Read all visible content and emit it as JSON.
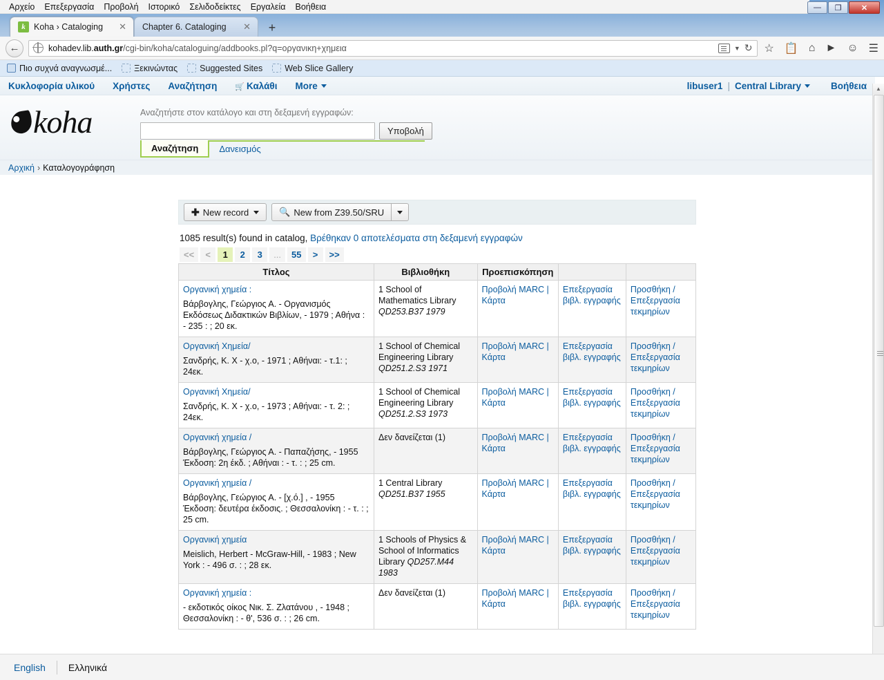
{
  "browser": {
    "menus": [
      "Αρχείο",
      "Επεξεργασία",
      "Προβολή",
      "Ιστορικό",
      "Σελιδοδείκτες",
      "Εργαλεία",
      "Βοήθεια"
    ],
    "window_controls": {
      "minimize": "—",
      "restore": "❐",
      "close": "✕"
    },
    "tabs": [
      {
        "title": "Koha › Cataloging",
        "favicon_letter": "k",
        "active": true,
        "close": "✕"
      },
      {
        "title": "Chapter 6. Cataloging",
        "active": false,
        "close": "✕"
      }
    ],
    "new_tab_label": "+",
    "url": {
      "prefix": "kohadev.lib.",
      "host_bold": "auth.gr",
      "path": "/cgi-bin/koha/cataloguing/addbooks.pl?q=οργανικη+χημεια"
    },
    "bookmarks": [
      {
        "label": "Πιο συχνά αναγνωσμέ...",
        "icon": "feed-icon"
      },
      {
        "label": "Ξεκινώντας",
        "icon": "bookmark-icon"
      },
      {
        "label": "Suggested Sites",
        "icon": "bookmark-icon"
      },
      {
        "label": "Web Slice Gallery",
        "icon": "bookmark-icon"
      }
    ]
  },
  "koha": {
    "nav": [
      {
        "label": "Κυκλοφορία υλικού"
      },
      {
        "label": "Χρήστες"
      },
      {
        "label": "Αναζήτηση"
      },
      {
        "label": "Καλάθι",
        "icon": "cart-icon"
      },
      {
        "label": "More",
        "caret": true
      }
    ],
    "user": "libuser1",
    "library": "Central Library",
    "help": "Βοήθεια",
    "logo_text": "koha",
    "search": {
      "label": "Αναζητήστε στον κατάλογο και στη δεξαμενή εγγραφών:",
      "value": "",
      "placeholder": "",
      "submit": "Υποβολή",
      "tabs": [
        {
          "label": "Αναζήτηση",
          "active": true
        },
        {
          "label": "Δανεισμός",
          "active": false
        }
      ]
    },
    "breadcrumb": {
      "home": "Αρχική",
      "sep": "›",
      "current": "Καταλογογράφηση"
    },
    "toolbar": {
      "new_record": "New record",
      "new_from_z3950": "New from Z39.50/SRU"
    },
    "results_summary_prefix": "1085 result(s) found in catalog,",
    "results_summary_link": "Βρέθηκαν 0 αποτελέσματα στη δεξαμενή εγγραφών",
    "pagination": [
      {
        "label": "<<",
        "state": "disabled"
      },
      {
        "label": "<",
        "state": "disabled"
      },
      {
        "label": "1",
        "state": "current"
      },
      {
        "label": "2",
        "state": "link"
      },
      {
        "label": "3",
        "state": "link"
      },
      {
        "label": "...",
        "state": "dots"
      },
      {
        "label": "55",
        "state": "link"
      },
      {
        "label": ">",
        "state": "link"
      },
      {
        "label": ">>",
        "state": "link"
      }
    ],
    "table": {
      "headers": [
        "Τίτλος",
        "Βιβλιοθήκη",
        "Προεπισκόπηση",
        "",
        ""
      ],
      "rows": [
        {
          "title": "Οργανική χημεία :",
          "details": "Βάρβογλης, Γεώργιος Α. - Οργανισμός Εκδόσεως Διδακτικών Βιβλίων, - 1979 ; Αθήνα : - 235 : ; 20 εκ.",
          "library": "1 School of Mathematics Library",
          "callno": "QD253.B37 1979",
          "preview": "Προβολή MARC | Κάρτα",
          "edit": "Επεξεργασία βιβλ. εγγραφής",
          "items": "Προσθήκη / Επεξεργασία τεκμηρίων"
        },
        {
          "title": "Οργανική Χημεία/",
          "details": "Σανδρής, Κ. Χ - χ.ο, - 1971 ; Αθήναι: - τ.1: ; 24εκ.",
          "library": "1 School of Chemical Engineering Library",
          "callno": "QD251.2.S3 1971",
          "preview": "Προβολή MARC | Κάρτα",
          "edit": "Επεξεργασία βιβλ. εγγραφής",
          "items": "Προσθήκη / Επεξεργασία τεκμηρίων"
        },
        {
          "title": "Οργανική Χημεία/",
          "details": "Σανδρής, Κ. Χ - χ.ο, - 1973 ; Αθήναι: - τ. 2: ; 24εκ.",
          "library": "1 School of Chemical Engineering Library",
          "callno": "QD251.2.S3 1973",
          "preview": "Προβολή MARC | Κάρτα",
          "edit": "Επεξεργασία βιβλ. εγγραφής",
          "items": "Προσθήκη / Επεξεργασία τεκμηρίων"
        },
        {
          "title": "Οργανική χημεία /",
          "details": "Βάρβογλης, Γεώργιος Α. - Παπαζήσης, - 1955 Έκδοση: 2η έκδ. ; Αθήναι : - τ. : ; 25 cm.",
          "library": "Δεν δανείζεται (1)",
          "callno": "",
          "preview": "Προβολή MARC | Κάρτα",
          "edit": "Επεξεργασία βιβλ. εγγραφής",
          "items": "Προσθήκη / Επεξεργασία τεκμηρίων"
        },
        {
          "title": "Οργανική χημεία /",
          "details": "Βάρβογλης, Γεώργιος Α. - [χ.ό.] , - 1955 Έκδοση: δευτέρα έκδοσις. ; Θεσσαλονίκη : - τ. : ; 25 cm.",
          "library": "1 Central Library",
          "callno": "QD251.B37 1955",
          "preview": "Προβολή MARC | Κάρτα",
          "edit": "Επεξεργασία βιβλ. εγγραφής",
          "items": "Προσθήκη / Επεξεργασία τεκμηρίων"
        },
        {
          "title": "Οργανική χημεία",
          "details": "Meislich, Herbert - McGraw-Hill, - 1983 ; New York : - 496 σ. : ; 28 εκ.",
          "library": "1 Schools of Physics & School of Informatics Library",
          "callno": "QD257.M44 1983",
          "preview": "Προβολή MARC | Κάρτα",
          "edit": "Επεξεργασία βιβλ. εγγραφής",
          "items": "Προσθήκη / Επεξεργασία τεκμηρίων"
        },
        {
          "title": "Οργανική χημεία :",
          "details": " - εκδοτικός οίκος Νικ. Σ. Ζλατάνου , - 1948 ; Θεσσαλονίκη : - θ', 536 σ. : ; 26 cm.",
          "library": "Δεν δανείζεται (1)",
          "callno": "",
          "preview": "Προβολή MARC | Κάρτα",
          "edit": "Επεξεργασία βιβλ. εγγραφής",
          "items": "Προσθήκη / Επεξεργασία τεκμηρίων"
        }
      ]
    },
    "languages": [
      {
        "label": "English",
        "active": false
      },
      {
        "label": "Ελληνικά",
        "active": true
      }
    ]
  },
  "colors": {
    "link": "#0b5c9e",
    "accent_green": "#9fce4e",
    "current_page_bg": "#e5f2b9",
    "toolbar_bg": "#eaf0f2"
  }
}
